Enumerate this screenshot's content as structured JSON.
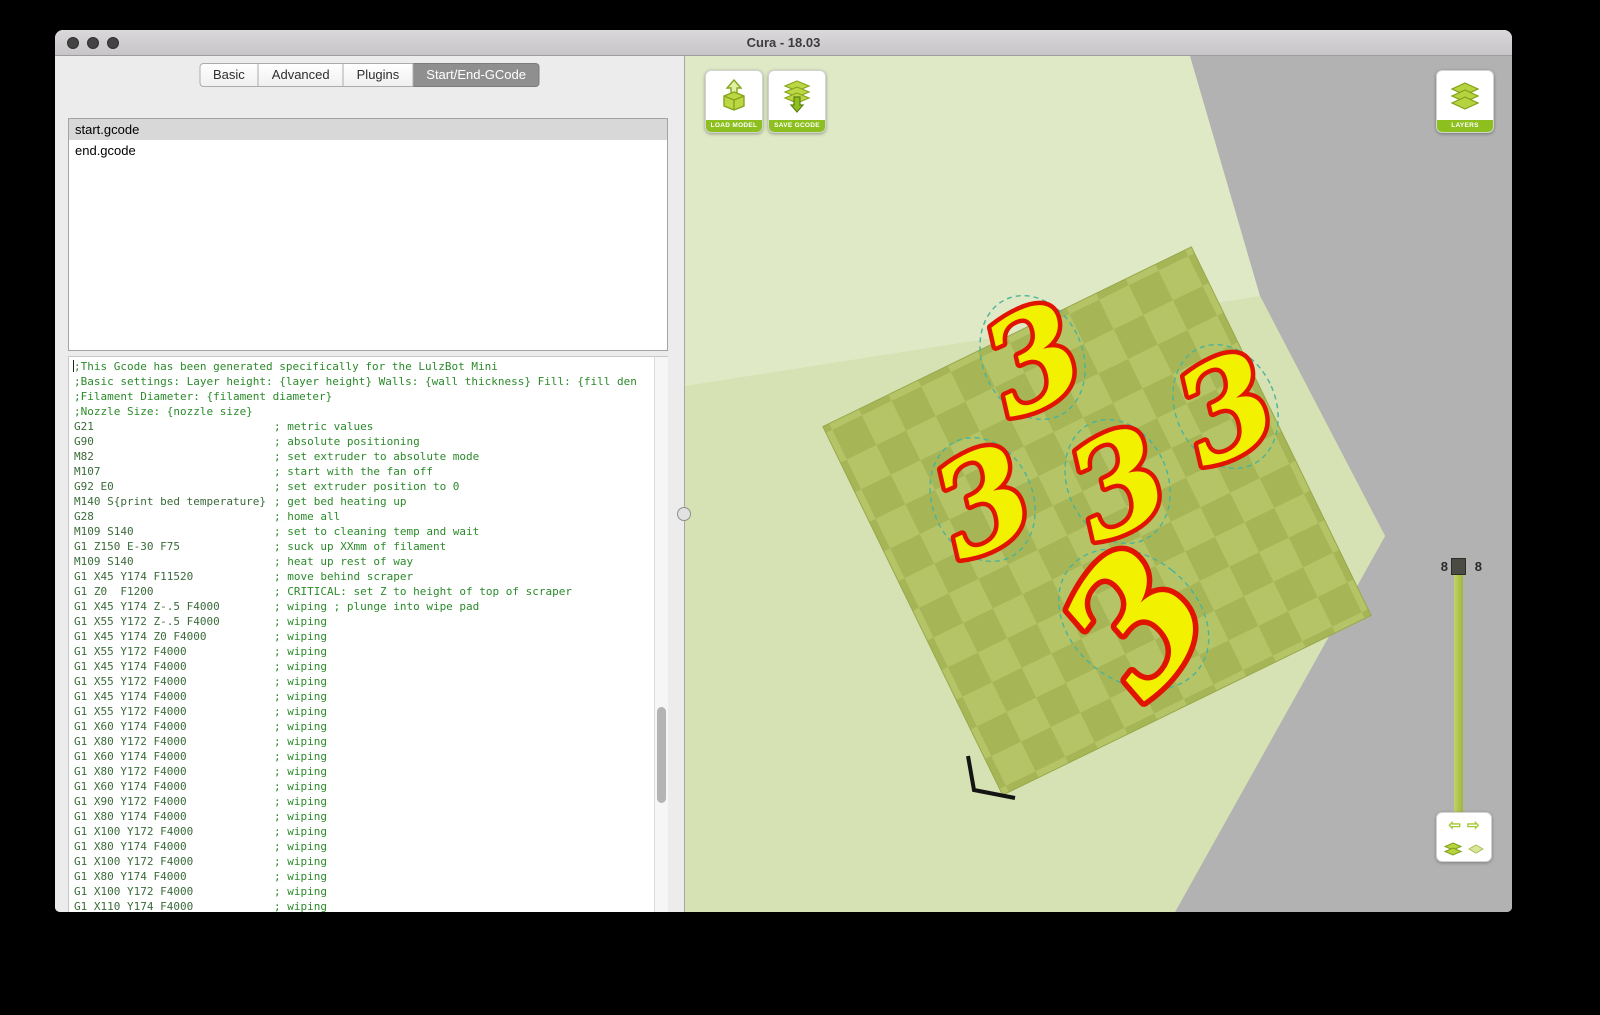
{
  "window": {
    "title": "Cura - 18.03"
  },
  "tabs": {
    "items": [
      {
        "label": "Basic"
      },
      {
        "label": "Advanced"
      },
      {
        "label": "Plugins"
      },
      {
        "label": "Start/End-GCode"
      }
    ],
    "active_index": 3
  },
  "file_list": {
    "items": [
      {
        "name": "start.gcode"
      },
      {
        "name": "end.gcode"
      }
    ],
    "selected_index": 0
  },
  "gcode_editor": {
    "lines": [
      {
        "cmd": "",
        "comment": ";This Gcode has been generated specifically for the LulzBot Mini"
      },
      {
        "cmd": "",
        "comment": ";Basic settings: Layer height: {layer height} Walls: {wall thickness} Fill: {fill den"
      },
      {
        "cmd": "",
        "comment": ";Filament Diameter: {filament diameter}"
      },
      {
        "cmd": "",
        "comment": ";Nozzle Size: {nozzle size}"
      },
      {
        "cmd": "G21",
        "comment": "; metric values"
      },
      {
        "cmd": "G90",
        "comment": "; absolute positioning"
      },
      {
        "cmd": "M82",
        "comment": "; set extruder to absolute mode"
      },
      {
        "cmd": "M107",
        "comment": "; start with the fan off"
      },
      {
        "cmd": "G92 E0",
        "comment": "; set extruder position to 0"
      },
      {
        "cmd": "M140 S{print bed temperature}",
        "comment": "; get bed heating up"
      },
      {
        "cmd": "G28",
        "comment": "; home all"
      },
      {
        "cmd": "M109 S140",
        "comment": "; set to cleaning temp and wait"
      },
      {
        "cmd": "G1 Z150 E-30 F75",
        "comment": "; suck up XXmm of filament"
      },
      {
        "cmd": "M109 S140",
        "comment": "; heat up rest of way"
      },
      {
        "cmd": "G1 X45 Y174 F11520",
        "comment": "; move behind scraper"
      },
      {
        "cmd": "G1 Z0  F1200",
        "comment": "; CRITICAL: set Z to height of top of scraper"
      },
      {
        "cmd": "G1 X45 Y174 Z-.5 F4000",
        "comment": "; wiping ; plunge into wipe pad"
      },
      {
        "cmd": "G1 X55 Y172 Z-.5 F4000",
        "comment": "; wiping"
      },
      {
        "cmd": "G1 X45 Y174 Z0 F4000",
        "comment": "; wiping"
      },
      {
        "cmd": "G1 X55 Y172 F4000",
        "comment": "; wiping"
      },
      {
        "cmd": "G1 X45 Y174 F4000",
        "comment": "; wiping"
      },
      {
        "cmd": "G1 X55 Y172 F4000",
        "comment": "; wiping"
      },
      {
        "cmd": "G1 X45 Y174 F4000",
        "comment": "; wiping"
      },
      {
        "cmd": "G1 X55 Y172 F4000",
        "comment": "; wiping"
      },
      {
        "cmd": "G1 X60 Y174 F4000",
        "comment": "; wiping"
      },
      {
        "cmd": "G1 X80 Y172 F4000",
        "comment": "; wiping"
      },
      {
        "cmd": "G1 X60 Y174 F4000",
        "comment": "; wiping"
      },
      {
        "cmd": "G1 X80 Y172 F4000",
        "comment": "; wiping"
      },
      {
        "cmd": "G1 X60 Y174 F4000",
        "comment": "; wiping"
      },
      {
        "cmd": "G1 X90 Y172 F4000",
        "comment": "; wiping"
      },
      {
        "cmd": "G1 X80 Y174 F4000",
        "comment": "; wiping"
      },
      {
        "cmd": "G1 X100 Y172 F4000",
        "comment": "; wiping"
      },
      {
        "cmd": "G1 X80 Y174 F4000",
        "comment": "; wiping"
      },
      {
        "cmd": "G1 X100 Y172 F4000",
        "comment": "; wiping"
      },
      {
        "cmd": "G1 X80 Y174 F4000",
        "comment": "; wiping"
      },
      {
        "cmd": "G1 X100 Y172 F4000",
        "comment": "; wiping"
      },
      {
        "cmd": "G1 X110 Y174 F4000",
        "comment": "; wiping"
      }
    ]
  },
  "viewport": {
    "buttons": {
      "load_model": "LOAD MODEL",
      "save_gcode": "SAVE GCODE",
      "layers": "LAYERS"
    },
    "layer_slider": {
      "value_left": "8",
      "value_right": "8"
    },
    "models": {
      "glyph": "3",
      "count": 5
    }
  },
  "colors": {
    "accent_green": "#8dbf1e",
    "model_fill": "#f2f200",
    "model_outline": "#e01400",
    "plate_light": "#b6c468",
    "plate_dark": "#a6b657",
    "volume_green": "#dfe9c6",
    "viewport_gray": "#b2b2b2"
  }
}
